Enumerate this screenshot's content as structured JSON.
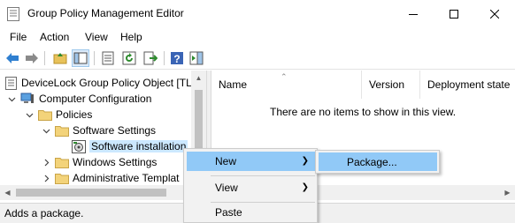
{
  "window": {
    "title": "Group Policy Management Editor",
    "icon": "group-policy-icon"
  },
  "menu": [
    "File",
    "Action",
    "View",
    "Help"
  ],
  "toolbar": {
    "icons": [
      "back-arrow-icon",
      "forward-arrow-icon",
      "up-folder-icon",
      "show-hide-tree-icon",
      "properties-icon",
      "refresh-icon",
      "export-list-icon",
      "help-icon",
      "show-action-pane-icon"
    ]
  },
  "tree": {
    "items": [
      {
        "label": "DeviceLock Group Policy Object [TL",
        "icon": "gpo-document-icon"
      },
      {
        "label": "Computer Configuration",
        "icon": "computer-icon"
      },
      {
        "label": "Policies",
        "icon": "folder-icon"
      },
      {
        "label": "Software Settings",
        "icon": "folder-icon"
      },
      {
        "label": "Software installation",
        "icon": "software-install-icon"
      },
      {
        "label": "Windows Settings",
        "icon": "folder-icon"
      },
      {
        "label": "Administrative Templat",
        "icon": "folder-icon"
      }
    ],
    "selected": "Software installation"
  },
  "list": {
    "columns": [
      "Name",
      "Version",
      "Deployment state"
    ],
    "empty_message": "There are no items to show in this view."
  },
  "status": {
    "text": "Adds a package."
  },
  "context_menu": {
    "items": [
      "New",
      "View",
      "Paste"
    ],
    "highlighted": "New"
  },
  "submenu": {
    "items": [
      "Package..."
    ]
  },
  "colors": {
    "highlight": "#91c9f7",
    "selection": "#cce8ff",
    "menu_bg": "#f2f2f2",
    "status_bg": "#f0f0f0"
  }
}
